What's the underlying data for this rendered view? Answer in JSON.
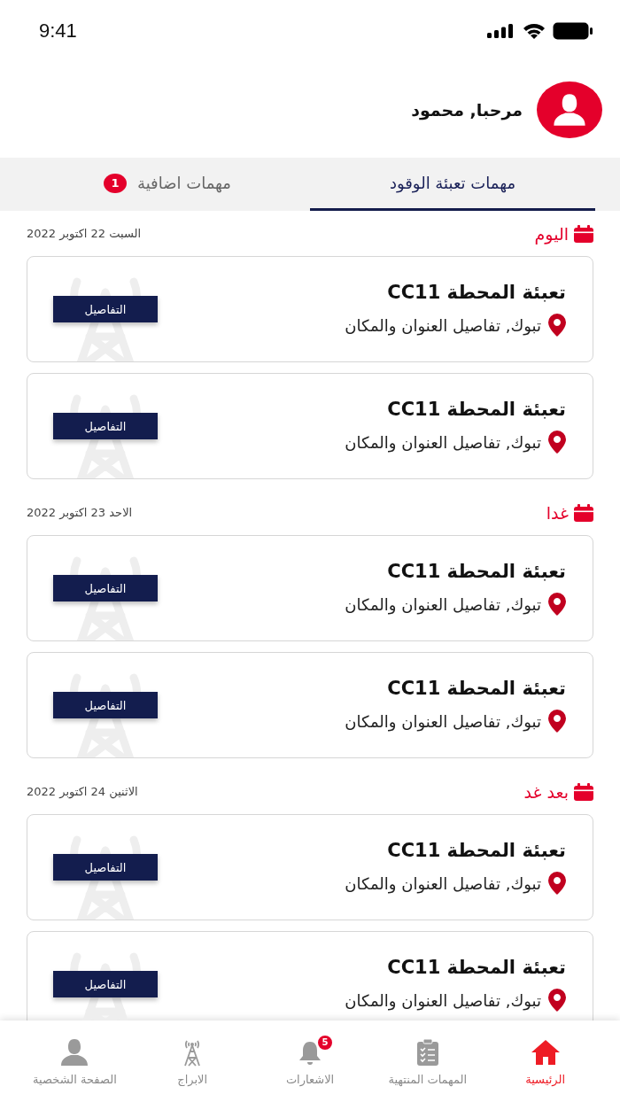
{
  "status_bar": {
    "time": "9:41"
  },
  "header": {
    "greeting": "مرحبا, محمود"
  },
  "tabs": [
    {
      "label": "مهمات تعبئة الوقود",
      "selected": true
    },
    {
      "label": "مهمات اضافية",
      "selected": false,
      "badge": "1"
    }
  ],
  "sections": [
    {
      "day": "اليوم",
      "date": "السبت  22  اكتوبر 2022",
      "tasks": [
        {
          "title": "تعبئة المحطة  CC11",
          "address": "تبوك, تفاصيل العنوان والمكان",
          "button": "التفاصيل"
        },
        {
          "title": "تعبئة المحطة  CC11",
          "address": "تبوك, تفاصيل العنوان والمكان",
          "button": "التفاصيل"
        }
      ]
    },
    {
      "day": "غدا",
      "date": "الاحد  23  اكتوبر 2022",
      "tasks": [
        {
          "title": "تعبئة المحطة  CC11",
          "address": "تبوك, تفاصيل العنوان والمكان",
          "button": "التفاصيل"
        },
        {
          "title": "تعبئة المحطة  CC11",
          "address": "تبوك, تفاصيل العنوان والمكان",
          "button": "التفاصيل"
        }
      ]
    },
    {
      "day": "بعد غد",
      "date": "الاثنين  24  اكتوبر 2022",
      "tasks": [
        {
          "title": "تعبئة المحطة  CC11",
          "address": "تبوك, تفاصيل العنوان والمكان",
          "button": "التفاصيل"
        },
        {
          "title": "تعبئة المحطة  CC11",
          "address": "تبوك, تفاصيل العنوان والمكان",
          "button": "التفاصيل"
        }
      ]
    }
  ],
  "nav": [
    {
      "kind": "home",
      "label": "الرئيسية",
      "selected": true
    },
    {
      "kind": "tasks",
      "label": "المهمات المنتهية",
      "selected": false
    },
    {
      "kind": "bell",
      "label": "الاشعارات",
      "selected": false,
      "badge": "5"
    },
    {
      "kind": "tower",
      "label": "الابراج",
      "selected": false
    },
    {
      "kind": "person",
      "label": "الصفحة الشخصية",
      "selected": false
    }
  ]
}
